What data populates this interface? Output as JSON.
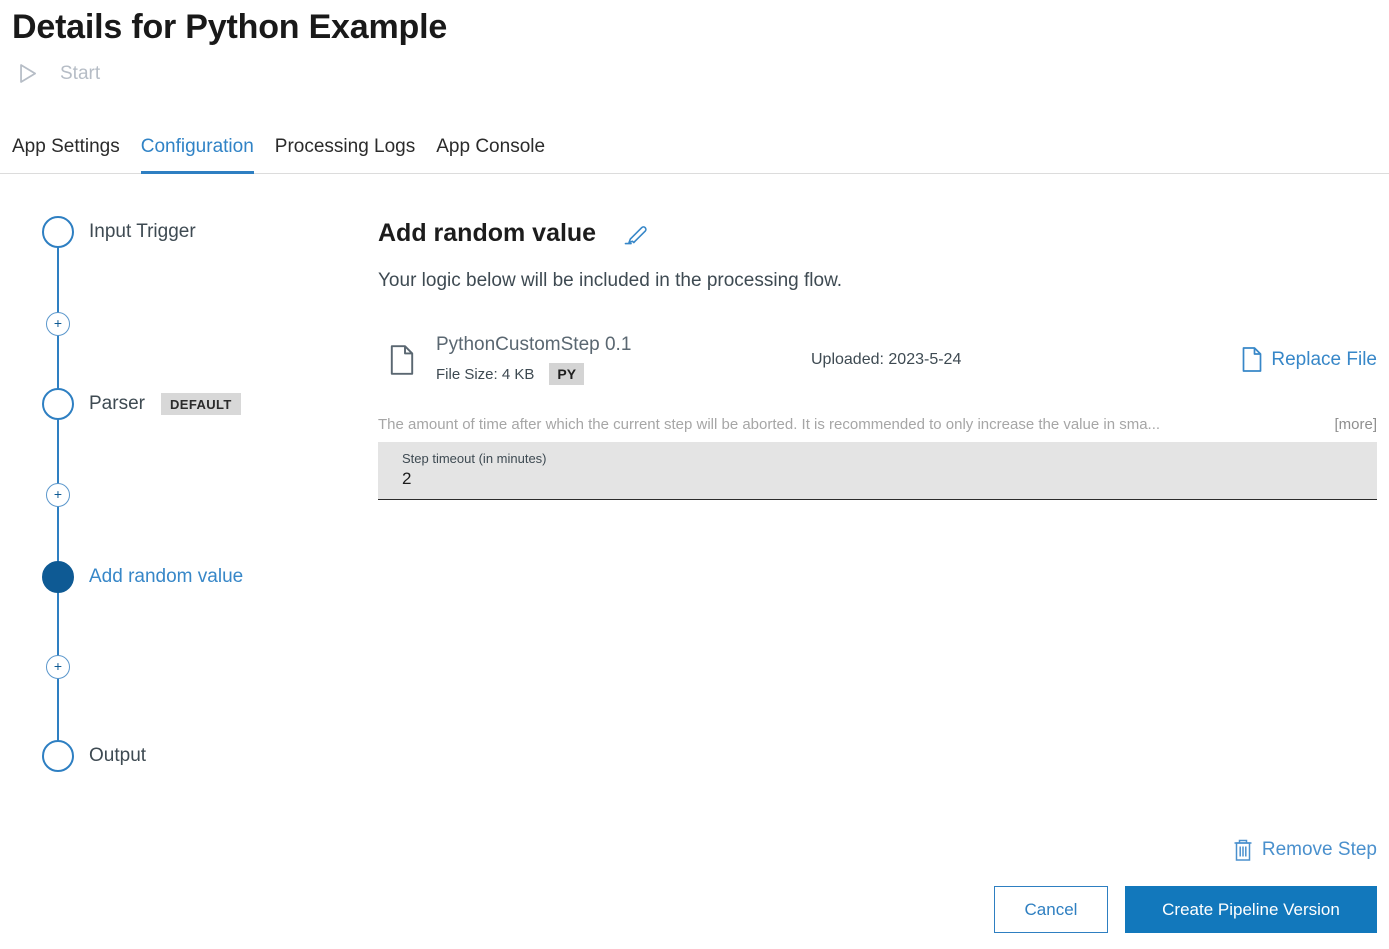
{
  "header": {
    "title": "Details for Python Example",
    "start_label": "Start"
  },
  "tabs": [
    {
      "label": "App Settings",
      "active": false
    },
    {
      "label": "Configuration",
      "active": true
    },
    {
      "label": "Processing Logs",
      "active": false
    },
    {
      "label": "App Console",
      "active": false
    }
  ],
  "stepper": {
    "steps": [
      {
        "label": "Input Trigger",
        "state": "default"
      },
      {
        "label": "Parser",
        "badge": "DEFAULT",
        "state": "default"
      },
      {
        "label": "Add random value",
        "state": "active"
      },
      {
        "label": "Output",
        "state": "default"
      }
    ],
    "add_step_symbol": "+"
  },
  "step_detail": {
    "heading": "Add random value",
    "description": "Your logic below will be included in the processing flow.",
    "file": {
      "name": "PythonCustomStep 0.1",
      "size_label": "File Size: 4 KB",
      "type_badge": "PY",
      "uploaded_label": "Uploaded: 2023-5-24",
      "replace_label": "Replace File"
    },
    "timeout": {
      "description": "The amount of time after which the current step will be aborted. It is recommended to only increase the value in sma...",
      "more_label": "[more]",
      "field_label": "Step timeout (in minutes)",
      "field_value": "2"
    }
  },
  "footer": {
    "remove_step_label": "Remove Step",
    "cancel_label": "Cancel",
    "create_label": "Create Pipeline Version"
  },
  "icons": {
    "start": "play-icon",
    "edit": "pencil-icon",
    "file": "document-icon",
    "replace_file": "document-icon",
    "remove_step": "trash-icon"
  },
  "colors": {
    "accent": "#3787c8",
    "tab_active": "#3083c6",
    "active_step_fill": "#0e5a94",
    "primary_button": "#1278bc",
    "badge_background": "#d8d8d8",
    "field_background": "#e4e4e4",
    "disabled_text": "#b6bdc6"
  }
}
